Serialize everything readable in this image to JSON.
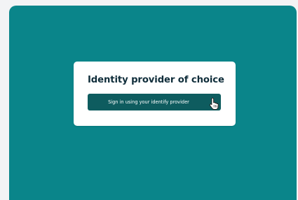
{
  "card": {
    "title": "Identity provider of choice",
    "button_label": "Sign in using your identify provider"
  },
  "colors": {
    "page_background": "#f3f3f5",
    "stage_background": "#0a858a",
    "card_background": "#ffffff",
    "button_background": "#0e5c5f",
    "title_color": "#0f2d3a"
  },
  "icons": {
    "cursor": "pointing-hand-cursor-icon"
  }
}
